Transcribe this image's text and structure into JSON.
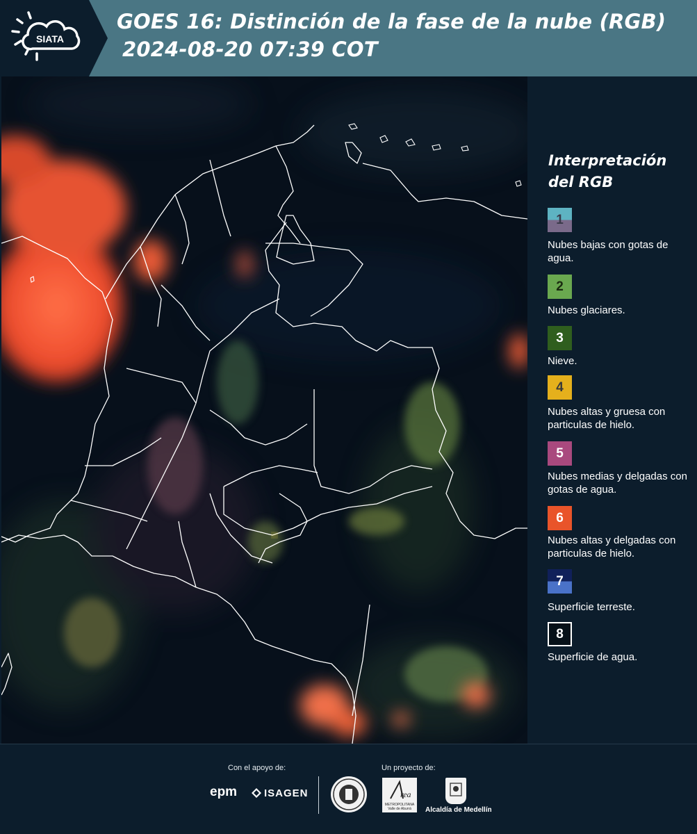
{
  "header": {
    "logo_text": "SIATA",
    "title_line1": "GOES 16: Distinción de la fase de la nube (RGB)",
    "title_line2": "2024-08-20 07:39 COT"
  },
  "legend": {
    "title": "Interpretación del RGB",
    "items": [
      {
        "number": "1",
        "label": "Nubes bajas con gotas de agua.",
        "color_top": "#5eb3c2",
        "color_bottom": "#7a6a8a"
      },
      {
        "number": "2",
        "label": "Nubes glaciares.",
        "color_top": "#6aa84f",
        "color_bottom": "#6aa84f"
      },
      {
        "number": "3",
        "label": "Nieve.",
        "color_top": "#2f5e1e",
        "color_bottom": "#2f5e1e"
      },
      {
        "number": "4",
        "label": "Nubes altas y gruesa con particulas de hielo.",
        "color_top": "#e5b01c",
        "color_bottom": "#e5b01c"
      },
      {
        "number": "5",
        "label": "Nubes medias y delgadas con gotas de agua.",
        "color_top": "#a9497e",
        "color_bottom": "#a9497e"
      },
      {
        "number": "6",
        "label": "Nubes altas y delgadas con particulas de hielo.",
        "color_top": "#e9542a",
        "color_bottom": "#e9542a"
      },
      {
        "number": "7",
        "label": "Superficie terreste.",
        "color_top": "#10205a",
        "color_bottom": "#4a72c8"
      },
      {
        "number": "8",
        "label": "Superficie de agua.",
        "color_top": "#061018",
        "color_bottom": "#061018"
      }
    ]
  },
  "footer": {
    "support_label": "Con el apoyo de:",
    "project_label": "Un proyecto de:",
    "sponsor1": "epm",
    "sponsor2": "ISAGEN",
    "partner_metro": "METROPOLITANA Valle de Aburrá",
    "partner_alcaldia": "Alcaldía de Medellín"
  }
}
